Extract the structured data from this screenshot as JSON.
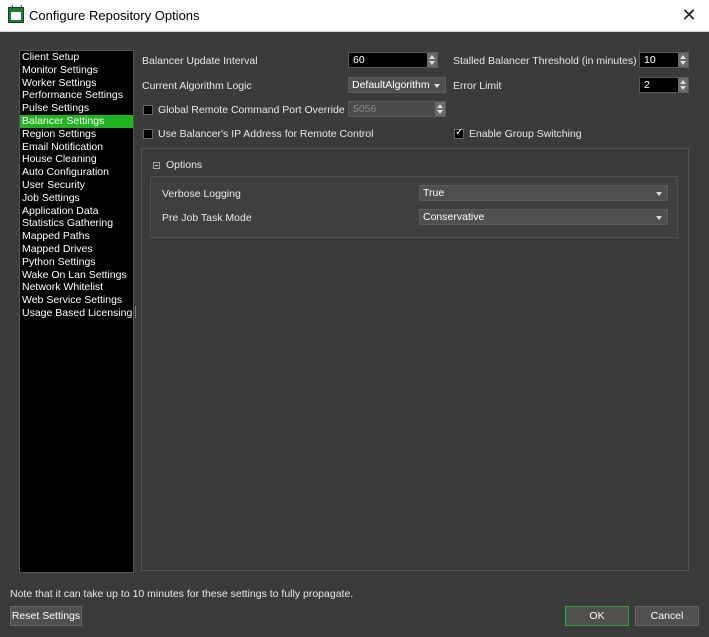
{
  "window": {
    "title": "Configure Repository Options",
    "close_glyph": "✕"
  },
  "sidebar": {
    "items": [
      {
        "label": "Client Setup"
      },
      {
        "label": "Monitor Settings"
      },
      {
        "label": "Worker Settings"
      },
      {
        "label": "Performance Settings"
      },
      {
        "label": "Pulse Settings"
      },
      {
        "label": "Balancer Settings",
        "active": true
      },
      {
        "label": "Region Settings"
      },
      {
        "label": "Email Notification"
      },
      {
        "label": "House Cleaning"
      },
      {
        "label": "Auto Configuration"
      },
      {
        "label": "User Security"
      },
      {
        "label": "Job Settings"
      },
      {
        "label": "Application Data"
      },
      {
        "label": "Statistics Gathering"
      },
      {
        "label": "Mapped Paths"
      },
      {
        "label": "Mapped Drives"
      },
      {
        "label": "Python Settings"
      },
      {
        "label": "Wake On Lan Settings"
      },
      {
        "label": "Network Whitelist"
      },
      {
        "label": "Web Service Settings"
      },
      {
        "label": "Usage Based Licensing"
      }
    ]
  },
  "balancer": {
    "update_interval_label": "Balancer Update Interval",
    "update_interval_value": "60",
    "stalled_threshold_label": "Stalled Balancer Threshold (in minutes)",
    "stalled_threshold_value": "10",
    "algorithm_label": "Current Algorithm Logic",
    "algorithm_value": "DefaultAlgorithm",
    "error_limit_label": "Error Limit",
    "error_limit_value": "2",
    "remote_port_override_label": "Global Remote Command Port Override",
    "remote_port_override_checked": false,
    "remote_port_value": "5056",
    "use_ip_label": "Use Balancer's IP Address for Remote Control",
    "use_ip_checked": false,
    "group_switching_label": "Enable Group Switching",
    "group_switching_checked": true
  },
  "options": {
    "header": "Options",
    "verbose_logging_label": "Verbose Logging",
    "verbose_logging_value": "True",
    "pre_job_task_mode_label": "Pre Job Task Mode",
    "pre_job_task_mode_value": "Conservative"
  },
  "footer": {
    "note": "Note that it can take up to 10 minutes for these settings to fully propagate.",
    "reset_label": "Reset Settings",
    "ok_label": "OK",
    "cancel_label": "Cancel"
  }
}
